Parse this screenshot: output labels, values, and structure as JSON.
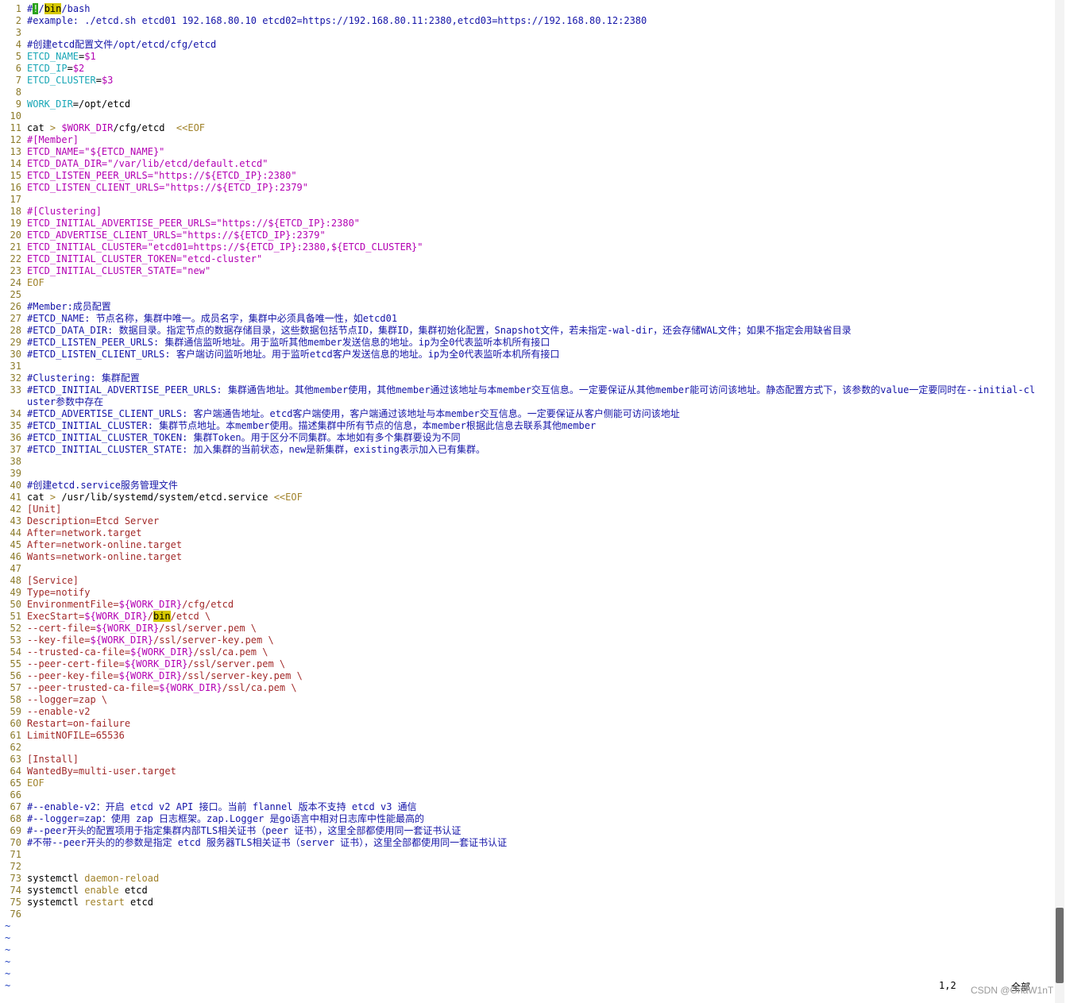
{
  "editor": {
    "lines": [
      {
        "n": "1",
        "t": [
          [
            "c",
            "#"
          ],
          [
            "cur",
            "!"
          ],
          [
            "c",
            "/"
          ],
          [
            "hl",
            "bin"
          ],
          [
            "c",
            "/bash"
          ]
        ]
      },
      {
        "n": "2",
        "t": [
          [
            "c",
            "#example: ./etcd.sh etcd01 192.168.80.10 etcd02=https://192.168.80.11:2380,etcd03=https://192.168.80.12:2380"
          ]
        ]
      },
      {
        "n": "3",
        "t": []
      },
      {
        "n": "4",
        "t": [
          [
            "c",
            "#创建etcd配置文件/opt/etcd/cfg/etcd"
          ]
        ]
      },
      {
        "n": "5",
        "t": [
          [
            "v",
            "ETCD_NAME"
          ],
          [
            "d",
            "="
          ],
          [
            "s",
            "$1"
          ]
        ]
      },
      {
        "n": "6",
        "t": [
          [
            "v",
            "ETCD_IP"
          ],
          [
            "d",
            "="
          ],
          [
            "s",
            "$2"
          ]
        ]
      },
      {
        "n": "7",
        "t": [
          [
            "v",
            "ETCD_CLUSTER"
          ],
          [
            "d",
            "="
          ],
          [
            "s",
            "$3"
          ]
        ]
      },
      {
        "n": "8",
        "t": []
      },
      {
        "n": "9",
        "t": [
          [
            "v",
            "WORK_DIR"
          ],
          [
            "d",
            "=/opt/etcd"
          ]
        ]
      },
      {
        "n": "10",
        "t": []
      },
      {
        "n": "11",
        "t": [
          [
            "d",
            "cat "
          ],
          [
            "k",
            ">"
          ],
          [
            "d",
            " "
          ],
          [
            "s",
            "$WORK_DIR"
          ],
          [
            "d",
            "/cfg/etcd  "
          ],
          [
            "k",
            "<<EOF"
          ]
        ]
      },
      {
        "n": "12",
        "t": [
          [
            "s",
            "#[Member]"
          ]
        ]
      },
      {
        "n": "13",
        "t": [
          [
            "s",
            "ETCD_NAME=\"${ETCD_NAME}\""
          ]
        ]
      },
      {
        "n": "14",
        "t": [
          [
            "s",
            "ETCD_DATA_DIR=\"/var/lib/etcd/default.etcd\""
          ]
        ]
      },
      {
        "n": "15",
        "t": [
          [
            "s",
            "ETCD_LISTEN_PEER_URLS=\"https://${ETCD_IP}:2380\""
          ]
        ]
      },
      {
        "n": "16",
        "t": [
          [
            "s",
            "ETCD_LISTEN_CLIENT_URLS=\"https://${ETCD_IP}:2379\""
          ]
        ]
      },
      {
        "n": "17",
        "t": []
      },
      {
        "n": "18",
        "t": [
          [
            "s",
            "#[Clustering]"
          ]
        ]
      },
      {
        "n": "19",
        "t": [
          [
            "s",
            "ETCD_INITIAL_ADVERTISE_PEER_URLS=\"https://${ETCD_IP}:2380\""
          ]
        ]
      },
      {
        "n": "20",
        "t": [
          [
            "s",
            "ETCD_ADVERTISE_CLIENT_URLS=\"https://${ETCD_IP}:2379\""
          ]
        ]
      },
      {
        "n": "21",
        "t": [
          [
            "s",
            "ETCD_INITIAL_CLUSTER=\"etcd01=https://${ETCD_IP}:2380,${ETCD_CLUSTER}\""
          ]
        ]
      },
      {
        "n": "22",
        "t": [
          [
            "s",
            "ETCD_INITIAL_CLUSTER_TOKEN=\"etcd-cluster\""
          ]
        ]
      },
      {
        "n": "23",
        "t": [
          [
            "s",
            "ETCD_INITIAL_CLUSTER_STATE=\"new\""
          ]
        ]
      },
      {
        "n": "24",
        "t": [
          [
            "k",
            "EOF"
          ]
        ]
      },
      {
        "n": "25",
        "t": []
      },
      {
        "n": "26",
        "t": [
          [
            "c",
            "#Member:成员配置"
          ]
        ]
      },
      {
        "n": "27",
        "t": [
          [
            "c",
            "#ETCD_NAME: 节点名称，集群中唯一。成员名字，集群中必须具备唯一性，如etcd01"
          ]
        ]
      },
      {
        "n": "28",
        "t": [
          [
            "c",
            "#ETCD_DATA_DIR: 数据目录。指定节点的数据存储目录，这些数据包括节点ID，集群ID，集群初始化配置，Snapshot文件，若未指定-wal-dir，还会存储WAL文件；如果不指定会用缺省目录"
          ]
        ]
      },
      {
        "n": "29",
        "t": [
          [
            "c",
            "#ETCD_LISTEN_PEER_URLS: 集群通信监听地址。用于监听其他member发送信息的地址。ip为全0代表监听本机所有接口"
          ]
        ]
      },
      {
        "n": "30",
        "t": [
          [
            "c",
            "#ETCD_LISTEN_CLIENT_URLS: 客户端访问监听地址。用于监听etcd客户发送信息的地址。ip为全0代表监听本机所有接口"
          ]
        ]
      },
      {
        "n": "31",
        "t": []
      },
      {
        "n": "32",
        "t": [
          [
            "c",
            "#Clustering: 集群配置"
          ]
        ]
      },
      {
        "n": "33",
        "wrap": true,
        "t": [
          [
            "c",
            "#ETCD_INITIAL_ADVERTISE_PEER_URLS: 集群通告地址。其他member使用，其他member通过该地址与本member交互信息。一定要保证从其他member能可访问该地址。静态配置方式下，该参数的value一定要同时在--initial-cluster参数中存在"
          ]
        ]
      },
      {
        "n": "34",
        "t": [
          [
            "c",
            "#ETCD_ADVERTISE_CLIENT_URLS: 客户端通告地址。etcd客户端使用，客户端通过该地址与本member交互信息。一定要保证从客户侧能可访问该地址"
          ]
        ]
      },
      {
        "n": "35",
        "t": [
          [
            "c",
            "#ETCD_INITIAL_CLUSTER: 集群节点地址。本member使用。描述集群中所有节点的信息，本member根据此信息去联系其他member"
          ]
        ]
      },
      {
        "n": "36",
        "t": [
          [
            "c",
            "#ETCD_INITIAL_CLUSTER_TOKEN: 集群Token。用于区分不同集群。本地如有多个集群要设为不同"
          ]
        ]
      },
      {
        "n": "37",
        "t": [
          [
            "c",
            "#ETCD_INITIAL_CLUSTER_STATE: 加入集群的当前状态，new是新集群，existing表示加入已有集群。"
          ]
        ]
      },
      {
        "n": "38",
        "t": []
      },
      {
        "n": "39",
        "t": []
      },
      {
        "n": "40",
        "t": [
          [
            "c",
            "#创建etcd.service服务管理文件"
          ]
        ]
      },
      {
        "n": "41",
        "t": [
          [
            "d",
            "cat "
          ],
          [
            "k",
            ">"
          ],
          [
            "d",
            " /usr/lib/systemd/system/etcd.service "
          ],
          [
            "k",
            "<<EOF"
          ]
        ]
      },
      {
        "n": "42",
        "t": [
          [
            "p",
            "[Unit]"
          ]
        ]
      },
      {
        "n": "43",
        "t": [
          [
            "p",
            "Description=Etcd Server"
          ]
        ]
      },
      {
        "n": "44",
        "t": [
          [
            "p",
            "After=network.target"
          ]
        ]
      },
      {
        "n": "45",
        "t": [
          [
            "p",
            "After=network-online.target"
          ]
        ]
      },
      {
        "n": "46",
        "t": [
          [
            "p",
            "Wants=network-online.target"
          ]
        ]
      },
      {
        "n": "47",
        "t": []
      },
      {
        "n": "48",
        "t": [
          [
            "p",
            "[Service]"
          ]
        ]
      },
      {
        "n": "49",
        "t": [
          [
            "p",
            "Type=notify"
          ]
        ]
      },
      {
        "n": "50",
        "t": [
          [
            "p",
            "EnvironmentFile="
          ],
          [
            "s",
            "${WORK_DIR}"
          ],
          [
            "p",
            "/cfg/etcd"
          ]
        ]
      },
      {
        "n": "51",
        "t": [
          [
            "p",
            "ExecStart="
          ],
          [
            "s",
            "${WORK_DIR}"
          ],
          [
            "p",
            "/"
          ],
          [
            "hl",
            "bin"
          ],
          [
            "p",
            "/etcd \\"
          ]
        ]
      },
      {
        "n": "52",
        "t": [
          [
            "p",
            "--cert-file="
          ],
          [
            "s",
            "${WORK_DIR}"
          ],
          [
            "p",
            "/ssl/server.pem \\"
          ]
        ]
      },
      {
        "n": "53",
        "t": [
          [
            "p",
            "--key-file="
          ],
          [
            "s",
            "${WORK_DIR}"
          ],
          [
            "p",
            "/ssl/server-key.pem \\"
          ]
        ]
      },
      {
        "n": "54",
        "t": [
          [
            "p",
            "--trusted-ca-file="
          ],
          [
            "s",
            "${WORK_DIR}"
          ],
          [
            "p",
            "/ssl/ca.pem \\"
          ]
        ]
      },
      {
        "n": "55",
        "t": [
          [
            "p",
            "--peer-cert-file="
          ],
          [
            "s",
            "${WORK_DIR}"
          ],
          [
            "p",
            "/ssl/server.pem \\"
          ]
        ]
      },
      {
        "n": "56",
        "t": [
          [
            "p",
            "--peer-key-file="
          ],
          [
            "s",
            "${WORK_DIR}"
          ],
          [
            "p",
            "/ssl/server-key.pem \\"
          ]
        ]
      },
      {
        "n": "57",
        "t": [
          [
            "p",
            "--peer-trusted-ca-file="
          ],
          [
            "s",
            "${WORK_DIR}"
          ],
          [
            "p",
            "/ssl/ca.pem \\"
          ]
        ]
      },
      {
        "n": "58",
        "t": [
          [
            "p",
            "--logger=zap \\"
          ]
        ]
      },
      {
        "n": "59",
        "t": [
          [
            "p",
            "--enable-v2"
          ]
        ]
      },
      {
        "n": "60",
        "t": [
          [
            "p",
            "Restart=on-failure"
          ]
        ]
      },
      {
        "n": "61",
        "t": [
          [
            "p",
            "LimitNOFILE=65536"
          ]
        ]
      },
      {
        "n": "62",
        "t": []
      },
      {
        "n": "63",
        "t": [
          [
            "p",
            "[Install]"
          ]
        ]
      },
      {
        "n": "64",
        "t": [
          [
            "p",
            "WantedBy=multi-user.target"
          ]
        ]
      },
      {
        "n": "65",
        "t": [
          [
            "k",
            "EOF"
          ]
        ]
      },
      {
        "n": "66",
        "t": []
      },
      {
        "n": "67",
        "t": [
          [
            "c",
            "#--enable-v2：开启 etcd v2 API 接口。当前 flannel 版本不支持 etcd v3 通信"
          ]
        ]
      },
      {
        "n": "68",
        "t": [
          [
            "c",
            "#--logger=zap：使用 zap 日志框架。zap.Logger 是go语言中相对日志库中性能最高的"
          ]
        ]
      },
      {
        "n": "69",
        "t": [
          [
            "c",
            "#--peer开头的配置项用于指定集群内部TLS相关证书（peer 证书），这里全部都使用同一套证书认证"
          ]
        ]
      },
      {
        "n": "70",
        "t": [
          [
            "c",
            "#不带--peer开头的的参数是指定 etcd 服务器TLS相关证书（server 证书），这里全部都使用同一套证书认证"
          ]
        ]
      },
      {
        "n": "71",
        "t": []
      },
      {
        "n": "72",
        "t": []
      },
      {
        "n": "73",
        "t": [
          [
            "d",
            "systemctl "
          ],
          [
            "k",
            "daemon-reload"
          ]
        ]
      },
      {
        "n": "74",
        "t": [
          [
            "d",
            "systemctl "
          ],
          [
            "k",
            "enable"
          ],
          [
            "d",
            " etcd"
          ]
        ]
      },
      {
        "n": "75",
        "t": [
          [
            "d",
            "systemctl "
          ],
          [
            "k",
            "restart"
          ],
          [
            "d",
            " etcd"
          ]
        ]
      },
      {
        "n": "76",
        "t": []
      }
    ],
    "tildes": [
      "~",
      "~",
      "~",
      "~",
      "~",
      "~"
    ]
  },
  "status": {
    "cursor_position": "1,2",
    "scroll_position": "全部"
  },
  "watermark": "CSDN @GnaW1nT",
  "scrollbar": {
    "thumb_position": 0.905,
    "thumb_size": 0.075
  },
  "colors": {
    "comment": "#1414a8",
    "variable": "#18a6b6",
    "string": "#b300b3",
    "keyword": "#a0822a",
    "preproc": "#a22a2a",
    "search_highlight": "#d6c800",
    "cursor": "#2aa21a"
  }
}
